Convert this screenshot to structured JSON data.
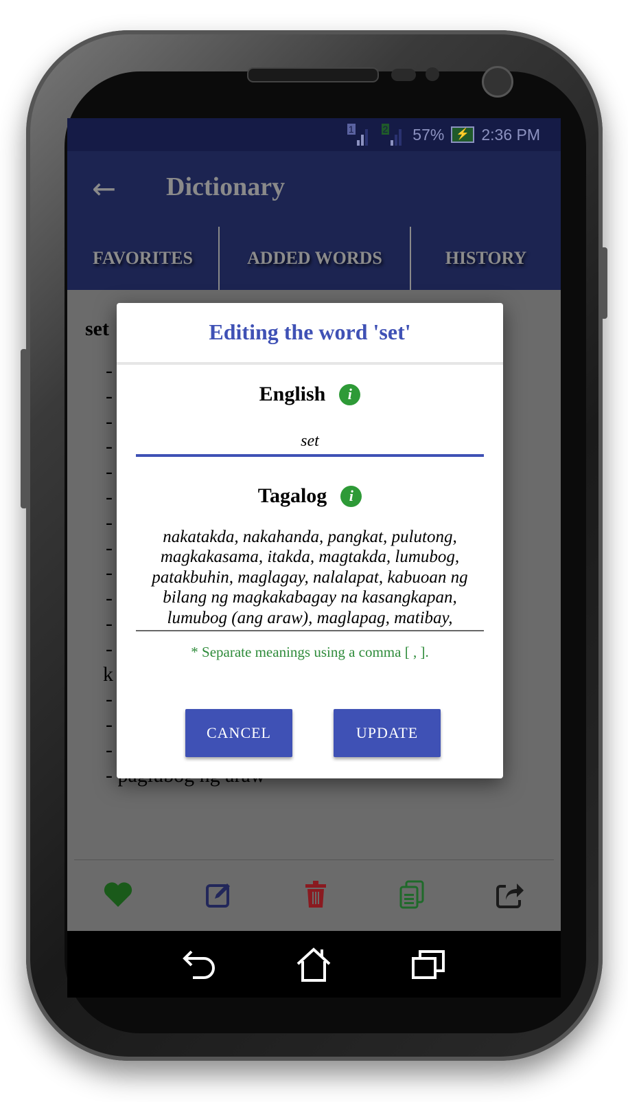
{
  "status_bar": {
    "sim1": "1",
    "sim2": "2",
    "battery": "57%",
    "time": "2:36 PM"
  },
  "app_bar": {
    "back_icon": "arrow-left-icon",
    "title": "Dictionary"
  },
  "tabs": [
    {
      "label": "FAVORITES"
    },
    {
      "label": "ADDED WORDS"
    },
    {
      "label": "HISTORY"
    }
  ],
  "content": {
    "word": "set",
    "meanings": [
      "-",
      "-",
      "-",
      "-",
      "-",
      "-",
      "-",
      "-",
      "-",
      "-",
      "-",
      "-",
      "k",
      "-",
      "-",
      "-",
      "- paglubog ng araw"
    ]
  },
  "dialog": {
    "title": "Editing the word 'set'",
    "english_label": "English",
    "english_value": "set",
    "tagalog_label": "Tagalog",
    "tagalog_value": "nakatakda, nakahanda, pangkat, pulutong, magkakasama, itakda, magtakda, lumubog, patakbuhin, maglagay, nalalapat, kabuoan ng bilang ng magkakabagay na kasangkapan, lumubog (ang araw), maglapag, matibay,",
    "info_icon": "i",
    "hint": "* Separate meanings using a comma [ , ].",
    "cancel_label": "CANCEL",
    "update_label": "UPDATE"
  },
  "actions": [
    "heart-icon",
    "edit-icon",
    "trash-icon",
    "copy-icon",
    "share-icon"
  ],
  "colors": {
    "primary": "#3f51b5",
    "primary_dark": "#303f9f",
    "info_green": "#2e9a37",
    "heart": "#1f7a1f",
    "trash": "#c0222a"
  }
}
